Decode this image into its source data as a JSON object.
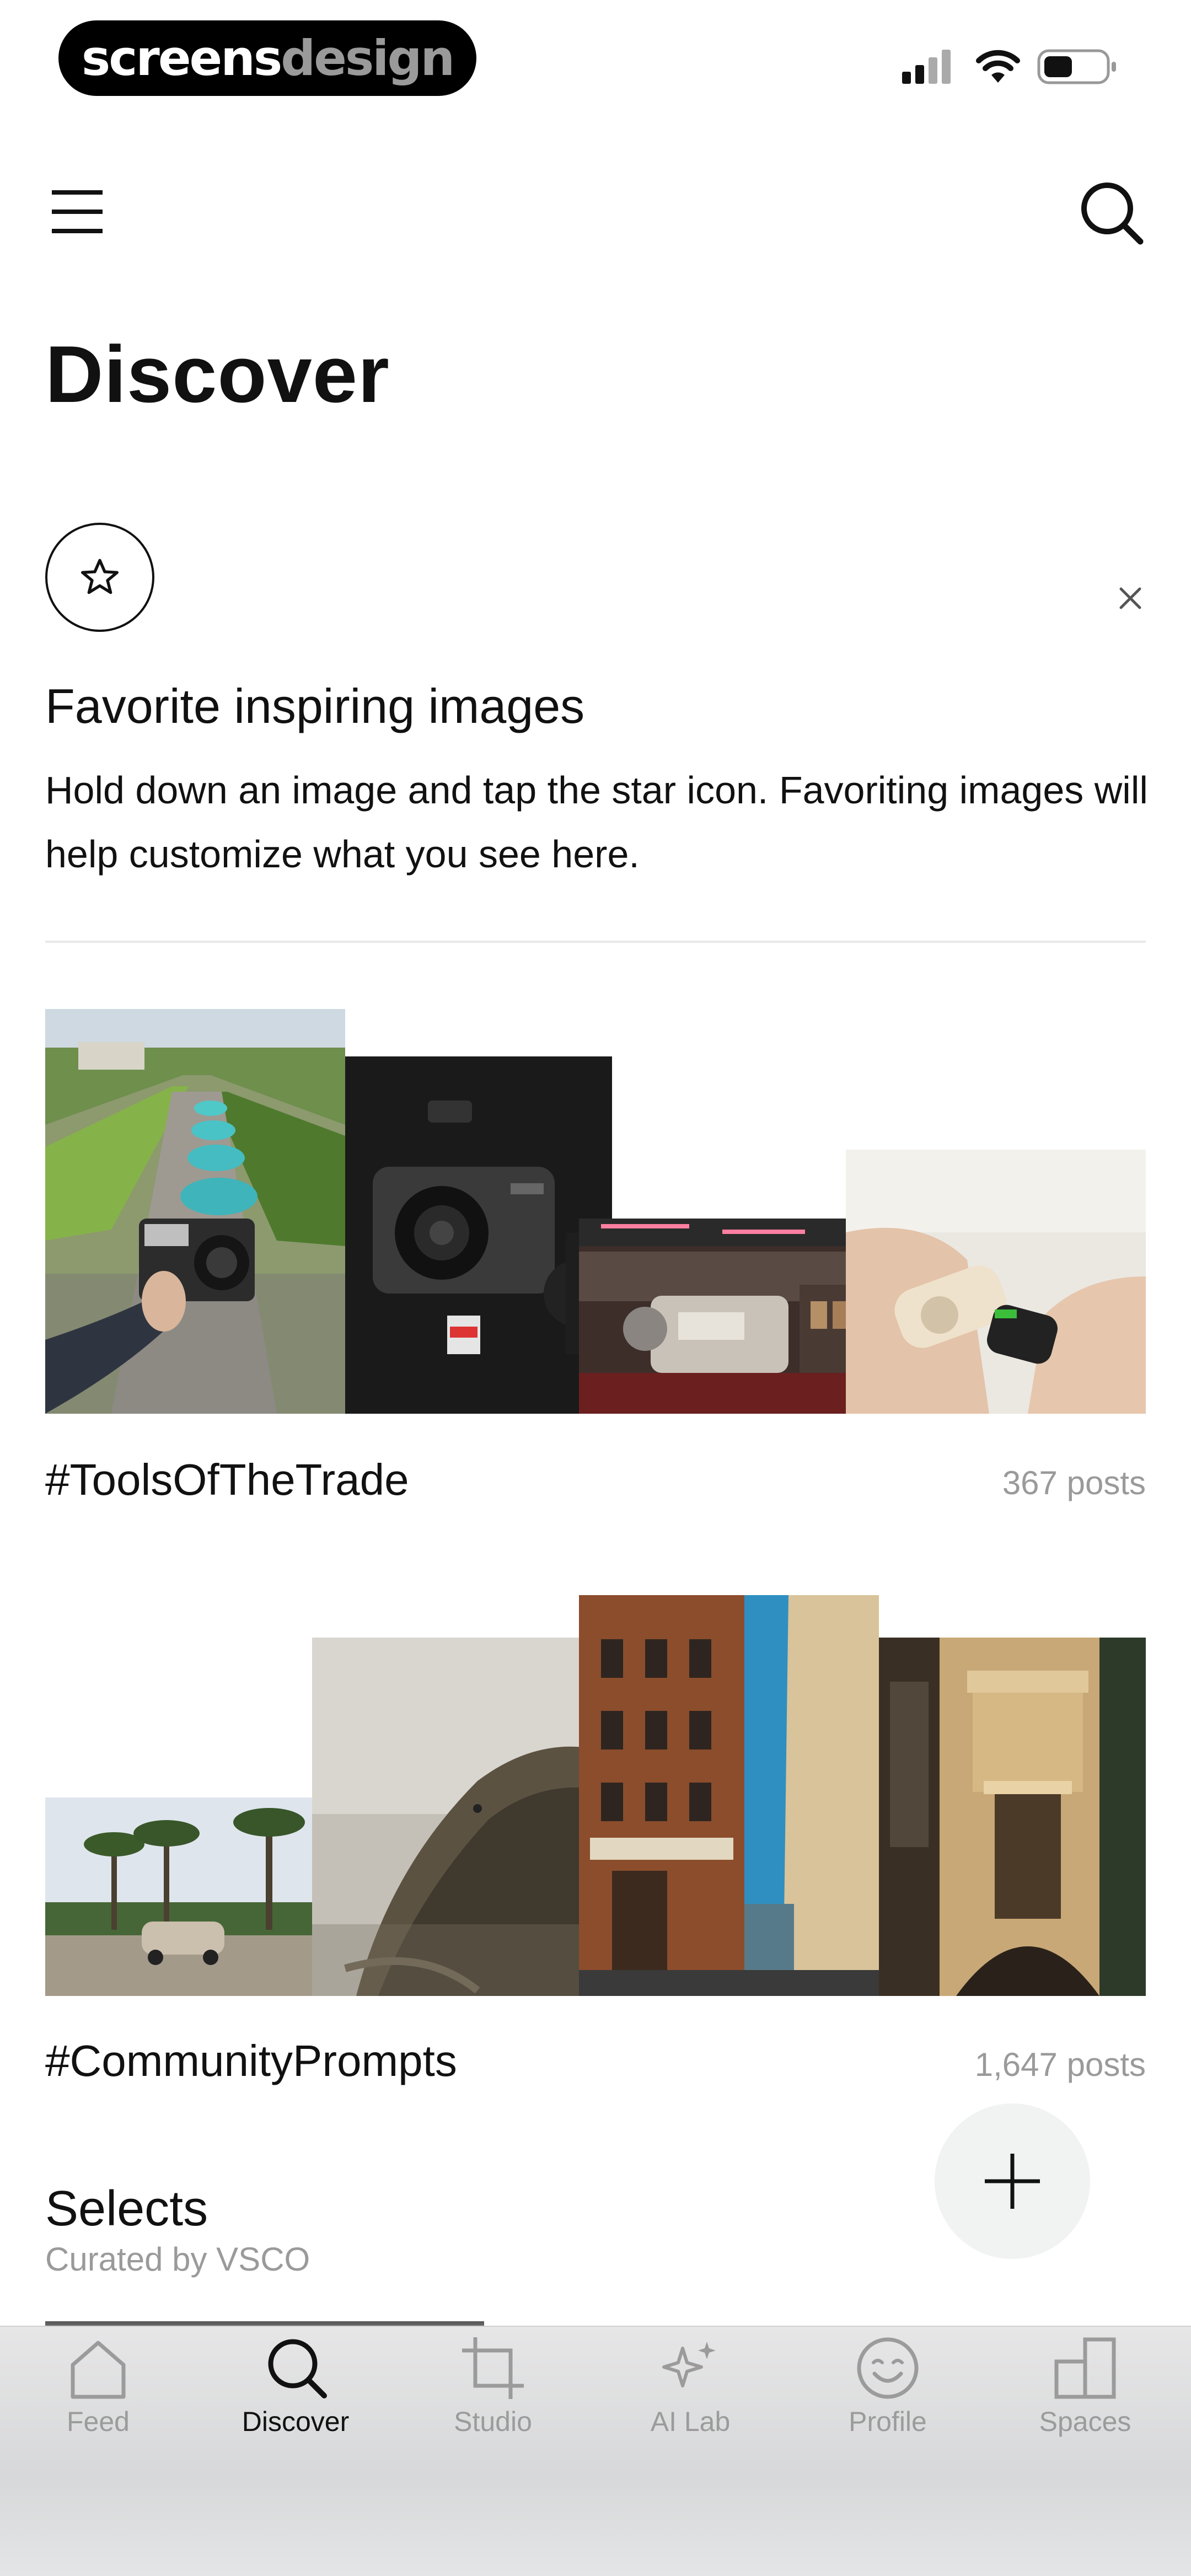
{
  "status_bar": {
    "brand_part1": "screens",
    "brand_part2": "design"
  },
  "header": {
    "title": "Discover"
  },
  "tip": {
    "title": "Favorite inspiring images",
    "body": "Hold down an image and tap the star icon. Favoriting images will help customize what you see here."
  },
  "collections": [
    {
      "title": "#ToolsOfTheTrade",
      "count": "367 posts"
    },
    {
      "title": "#CommunityPrompts",
      "count": "1,647 posts"
    }
  ],
  "selects": {
    "title": "Selects",
    "subtitle": "Curated by VSCO"
  },
  "tabs": [
    {
      "label": "Feed",
      "icon": "home-icon"
    },
    {
      "label": "Discover",
      "icon": "search-icon",
      "active": true
    },
    {
      "label": "Studio",
      "icon": "crop-icon"
    },
    {
      "label": "AI Lab",
      "icon": "sparkle-icon"
    },
    {
      "label": "Profile",
      "icon": "smiley-icon"
    },
    {
      "label": "Spaces",
      "icon": "spaces-icon"
    }
  ],
  "colors": {
    "accent": "#111111",
    "muted": "#9a9a9a",
    "fab_bg": "#f1f2f2"
  }
}
